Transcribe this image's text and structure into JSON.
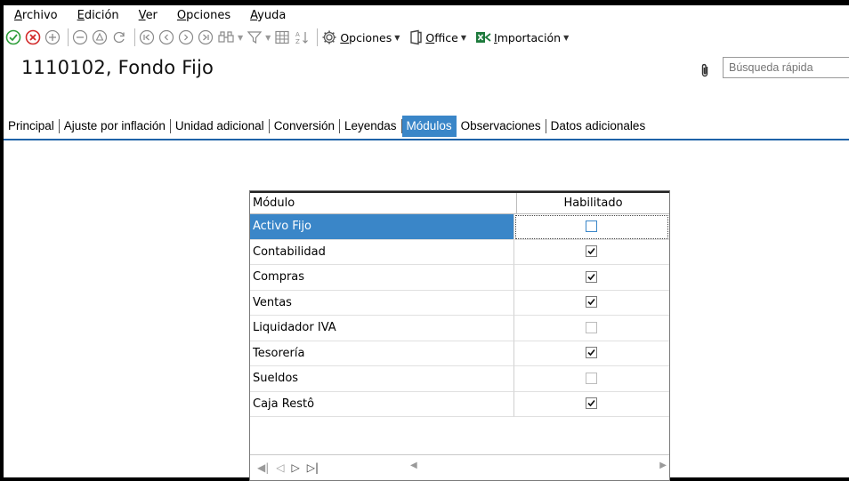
{
  "menu": [
    "Archivo",
    "Edición",
    "Ver",
    "Opciones",
    "Ayuda"
  ],
  "toolbar": {
    "opciones_label": "Opciones",
    "office_label": "Office",
    "importacion_label": "Importación"
  },
  "record": {
    "title": "1110102, Fondo Fijo"
  },
  "search": {
    "placeholder": "Búsqueda rápida"
  },
  "tabs": [
    "Principal",
    "Ajuste por inflación",
    "Unidad adicional",
    "Conversión",
    "Leyendas",
    "Módulos",
    "Observaciones",
    "Datos adicionales"
  ],
  "active_tab": "Módulos",
  "grid": {
    "headers": [
      "Módulo",
      "Habilitado"
    ],
    "rows": [
      {
        "module": "Activo Fijo",
        "enabled": false
      },
      {
        "module": "Contabilidad",
        "enabled": true
      },
      {
        "module": "Compras",
        "enabled": true
      },
      {
        "module": "Ventas",
        "enabled": true
      },
      {
        "module": "Liquidador IVA",
        "enabled": false
      },
      {
        "module": "Tesorería",
        "enabled": true
      },
      {
        "module": "Sueldos",
        "enabled": false
      },
      {
        "module": "Caja Restô",
        "enabled": true
      }
    ]
  },
  "colors": {
    "accent": "#3a86c8",
    "tab_line": "#1f63a8",
    "ok_green": "#2e9e3a",
    "cancel_red": "#d22a2a"
  }
}
